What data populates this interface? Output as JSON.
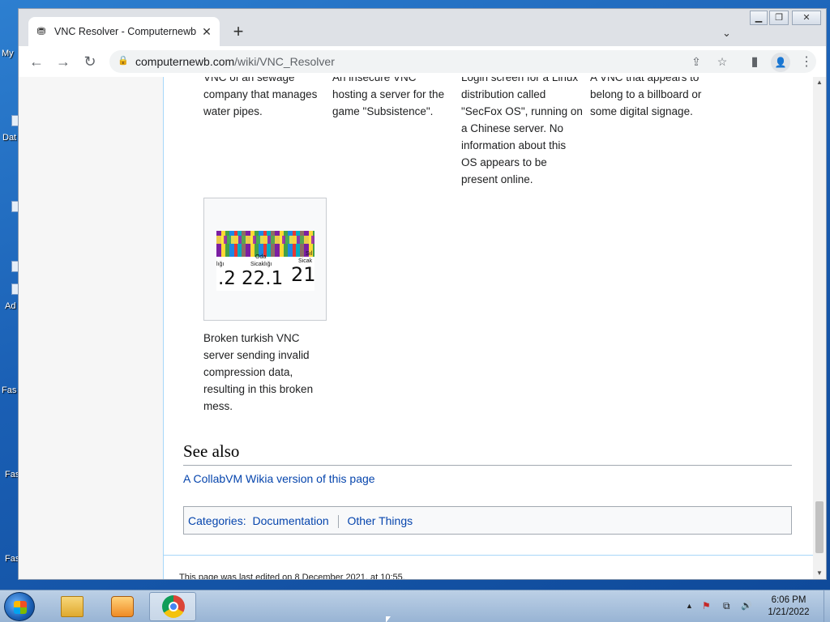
{
  "desktop": {
    "icon_labels": [
      "My",
      "Dat",
      "Ad",
      "Fas",
      "Fas",
      "Fas"
    ]
  },
  "browser": {
    "tab": {
      "title": "VNC Resolver - Computernewb W",
      "favicon": "wiki-favicon-icon",
      "close": "✕"
    },
    "new_tab": "+",
    "tab_search": "⌄",
    "window_controls": {
      "minimize": "▁",
      "restore": "❐",
      "close": "✕"
    },
    "url_host": "computernewb.com",
    "url_path": "/wiki/VNC_Resolver",
    "nav": {
      "back": "←",
      "forward": "→",
      "reload": "↻"
    },
    "omnibox_icons": {
      "share": "⇪",
      "bookmark": "☆"
    },
    "toolbar_icons": {
      "sidepanel": "▮",
      "profile": "👤",
      "menu": "⋮"
    }
  },
  "page": {
    "captions": [
      "VNC of an sewage company that manages water pipes.",
      "An insecure VNC hosting a server for the game \"Subsistence\".",
      "Login screen for a Linux distribution called \"SecFox OS\", running on a Chinese server. No information about this OS appears to be present online.",
      "A VNC that appears to belong to a billboard or some digital signage."
    ],
    "thumbnail": {
      "labels": [
        "Oda",
        "Sicaklığı",
        "lığı",
        "Sicak",
        "Sıl"
      ],
      "values": [
        ".2",
        "22.1",
        "21"
      ]
    },
    "thumbnail_caption": "Broken turkish VNC server sending invalid compression data, resulting in this broken mess.",
    "see_also": {
      "heading": "See also",
      "link": "A CollabVM Wikia version of this page"
    },
    "categories": {
      "label": "Categories:",
      "items": [
        "Documentation",
        "Other Things"
      ]
    },
    "footer": "This page was last edited on 8 December 2021, at 10:55."
  },
  "taskbar": {
    "time": "6:06 PM",
    "date": "1/21/2022",
    "tray_icons": {
      "arrow": "▲",
      "flag": "⚑",
      "network": "⧉",
      "volume": "🔊"
    }
  }
}
